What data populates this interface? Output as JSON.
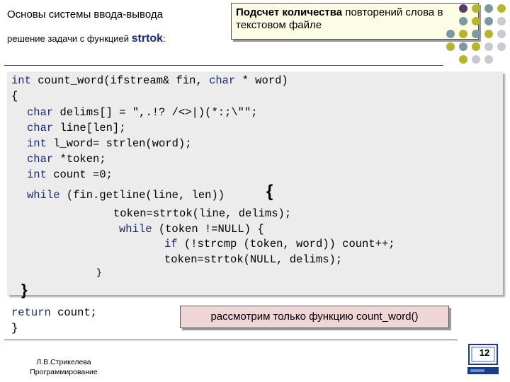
{
  "header": {
    "title": "Основы системы ввода-вывода",
    "subtitle_text": "решение задачи с функцией",
    "subtitle_keyword": "strtok",
    "subtitle_suffix": ":"
  },
  "task": {
    "bold_part": "Подсчет количества",
    "rest": " повторений слова в текстовом файле"
  },
  "code": {
    "lines": [
      {
        "kw": "int",
        "text": " count_word(ifstream& fin, ",
        "kw2": "char",
        "text2": " * word)"
      },
      {
        "text": "{"
      },
      {
        "kw": "char",
        "text": " delims[] = \",.!? /<>|)(*:;\\\"\";"
      },
      {
        "kw": "char",
        "text": " line[len];"
      },
      {
        "kw": "int",
        "text": " l_word= strlen(word);"
      },
      {
        "kw": "char",
        "text": " *token;"
      },
      {
        "kw": "int",
        "text": " count =0;"
      },
      {
        "kw": "while",
        "text": " (fin.getline(line, len))"
      },
      {
        "text": "token=strtok(line, delims);"
      },
      {
        "kw": "while",
        "text": " (token !=NULL) {"
      },
      {
        "kw": "if",
        "text": " (!strcmp (token, word)) count++;"
      },
      {
        "text": "token=strtok(NULL, delims);"
      },
      {
        "text": "}"
      },
      {
        "text": "}"
      },
      {
        "kw": "return",
        "text": " count;"
      },
      {
        "text": "}"
      }
    ]
  },
  "note": "рассмотрим только функцию count_word()",
  "footer": {
    "author": "Л.В.Стрикелева",
    "course": "Программирование"
  },
  "page_number": "12",
  "colors": {
    "accent_olive": "#b5b52e",
    "accent_teal": "#7a9aa0",
    "accent_purple": "#5a3a6a",
    "accent_grey": "#c9c9d2",
    "code_bg": "#ececec",
    "note_bg": "#efd5d5",
    "task_bg": "#fdfde6"
  }
}
